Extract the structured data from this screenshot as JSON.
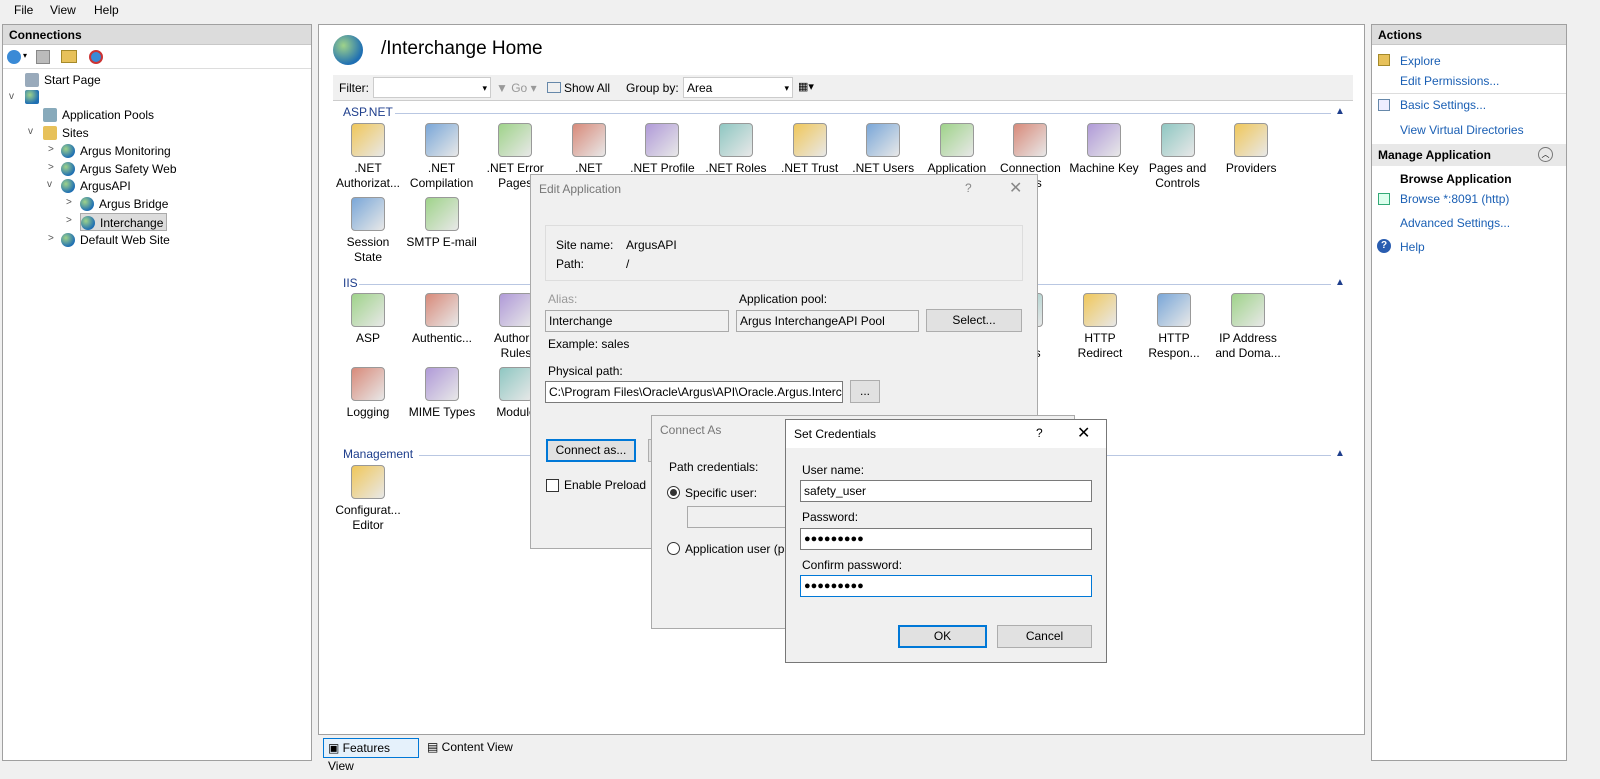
{
  "menu": {
    "file": "File",
    "view": "View",
    "help": "Help"
  },
  "connections": {
    "title": "Connections",
    "tree": {
      "start_page": "Start Page",
      "app_pools": "Application Pools",
      "sites": "Sites",
      "argus_monitoring": "Argus Monitoring",
      "argus_safety_web": "Argus Safety Web",
      "argusapi": "ArgusAPI",
      "argus_bridge": "Argus Bridge",
      "interchange": "Interchange",
      "default_web_site": "Default Web Site"
    }
  },
  "center": {
    "title": "/Interchange Home",
    "filter_label": "Filter:",
    "go": "Go",
    "show_all": "Show All",
    "group_by_label": "Group by:",
    "group_by_value": "Area",
    "sections": {
      "aspnet": "ASP.NET",
      "iis": "IIS",
      "management": "Management"
    },
    "aspnet": [
      {
        "l1": ".NET",
        "l2": "Authorizat..."
      },
      {
        "l1": ".NET",
        "l2": "Compilation"
      },
      {
        "l1": ".NET Error",
        "l2": "Pages"
      },
      {
        "l1": ".NET",
        "l2": ""
      },
      {
        "l1": ".NET Profile",
        "l2": ""
      },
      {
        "l1": ".NET Roles",
        "l2": ""
      },
      {
        "l1": ".NET Trust",
        "l2": ""
      },
      {
        "l1": ".NET Users",
        "l2": ""
      },
      {
        "l1": "Application",
        "l2": ""
      },
      {
        "l1": "Connection",
        "l2": "...gs"
      },
      {
        "l1": "Machine Key",
        "l2": ""
      },
      {
        "l1": "Pages and",
        "l2": "Controls"
      },
      {
        "l1": "Providers",
        "l2": ""
      },
      {
        "l1": "Session State",
        "l2": ""
      },
      {
        "l1": "SMTP E-mail",
        "l2": ""
      }
    ],
    "iis": [
      {
        "l1": "ASP",
        "l2": ""
      },
      {
        "l1": "Authentic...",
        "l2": ""
      },
      {
        "l1": "Authoriz",
        "l2": "Rules"
      },
      {
        "l1": "...ler",
        "l2": "...ngs"
      },
      {
        "l1": "HTTP",
        "l2": "Redirect"
      },
      {
        "l1": "HTTP",
        "l2": "Respon..."
      },
      {
        "l1": "IP Address",
        "l2": "and Doma..."
      },
      {
        "l1": "Logging",
        "l2": ""
      },
      {
        "l1": "MIME Types",
        "l2": ""
      },
      {
        "l1": "Module",
        "l2": ""
      }
    ],
    "management": [
      {
        "l1": "Configurat...",
        "l2": "Editor"
      }
    ],
    "tabs": {
      "features": "Features View",
      "content": "Content View"
    }
  },
  "actions": {
    "title": "Actions",
    "explore": "Explore",
    "edit_permissions": "Edit Permissions...",
    "basic_settings": "Basic Settings...",
    "view_virtual_dirs": "View Virtual Directories",
    "manage_app_title": "Manage Application",
    "browse_app_title": "Browse Application",
    "browse_8091": "Browse *:8091 (http)",
    "advanced_settings": "Advanced Settings...",
    "help": "Help"
  },
  "edit_app": {
    "title": "Edit Application",
    "help": "?",
    "site_name_label": "Site name:",
    "site_name": "ArgusAPI",
    "path_label": "Path:",
    "path": "/",
    "alias_label": "Alias:",
    "alias": "Interchange",
    "app_pool_label": "Application pool:",
    "app_pool": "Argus InterchangeAPI Pool",
    "select_btn": "Select...",
    "example": "Example: sales",
    "physical_path_label": "Physical path:",
    "physical_path": "C:\\Program Files\\Oracle\\Argus\\API\\Oracle.Argus.Interch",
    "browse_btn": "...",
    "connect_as_btn": "Connect as...",
    "enable_preload": "Enable Preload"
  },
  "connect_as": {
    "title": "Connect As",
    "path_credentials": "Path credentials:",
    "specific_user": "Specific user:",
    "application_user": "Application user (pa"
  },
  "set_credentials": {
    "title": "Set Credentials",
    "help": "?",
    "username_label": "User name:",
    "username": "safety_user",
    "password_label": "Password:",
    "password": "●●●●●●●●●",
    "confirm_label": "Confirm password:",
    "confirm": "●●●●●●●●●",
    "ok": "OK",
    "cancel": "Cancel"
  }
}
